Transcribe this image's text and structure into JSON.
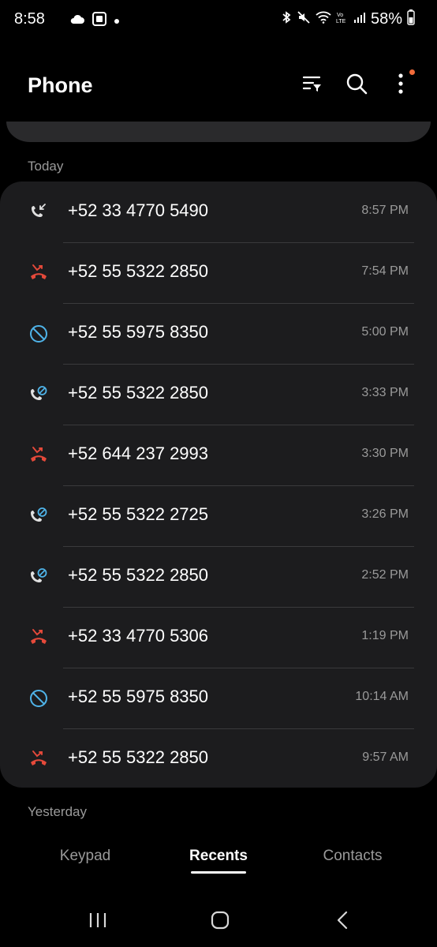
{
  "status_bar": {
    "time": "8:58",
    "battery": "58%",
    "left_icons": [
      "cloud-icon",
      "screen-record-icon",
      "dot-icon"
    ],
    "right_icons": [
      "bluetooth-icon",
      "mute-icon",
      "wifi-icon",
      "volte-icon",
      "signal-icon",
      "battery-icon"
    ]
  },
  "header": {
    "title": "Phone",
    "actions": [
      "filter-icon",
      "search-icon",
      "more-options-icon"
    ]
  },
  "sections": {
    "today": "Today",
    "yesterday": "Yesterday"
  },
  "calls": [
    {
      "type": "incoming",
      "number": "+52 33 4770 5490",
      "time": "8:57 PM"
    },
    {
      "type": "missed",
      "number": "+52 55 5322 2850",
      "time": "7:54 PM"
    },
    {
      "type": "blocked",
      "number": "+52 55 5975 8350",
      "time": "5:00 PM"
    },
    {
      "type": "rejected",
      "number": "+52 55 5322 2850",
      "time": "3:33 PM"
    },
    {
      "type": "missed",
      "number": "+52 644 237 2993",
      "time": "3:30 PM"
    },
    {
      "type": "rejected",
      "number": "+52 55 5322 2725",
      "time": "3:26 PM"
    },
    {
      "type": "rejected",
      "number": "+52 55 5322 2850",
      "time": "2:52 PM"
    },
    {
      "type": "missed",
      "number": "+52 33 4770 5306",
      "time": "1:19 PM"
    },
    {
      "type": "blocked",
      "number": "+52 55 5975 8350",
      "time": "10:14 AM"
    },
    {
      "type": "missed",
      "number": "+52 55 5322 2850",
      "time": "9:57 AM"
    }
  ],
  "tabs": [
    {
      "label": "Keypad",
      "active": false
    },
    {
      "label": "Recents",
      "active": true
    },
    {
      "label": "Contacts",
      "active": false
    }
  ],
  "colors": {
    "background": "#000000",
    "card": "#1c1c1e",
    "missed": "#e5493a",
    "blocked": "#4fb3e8",
    "secondary_text": "#9a9a9a",
    "notification_dot": "#f26b3a"
  }
}
